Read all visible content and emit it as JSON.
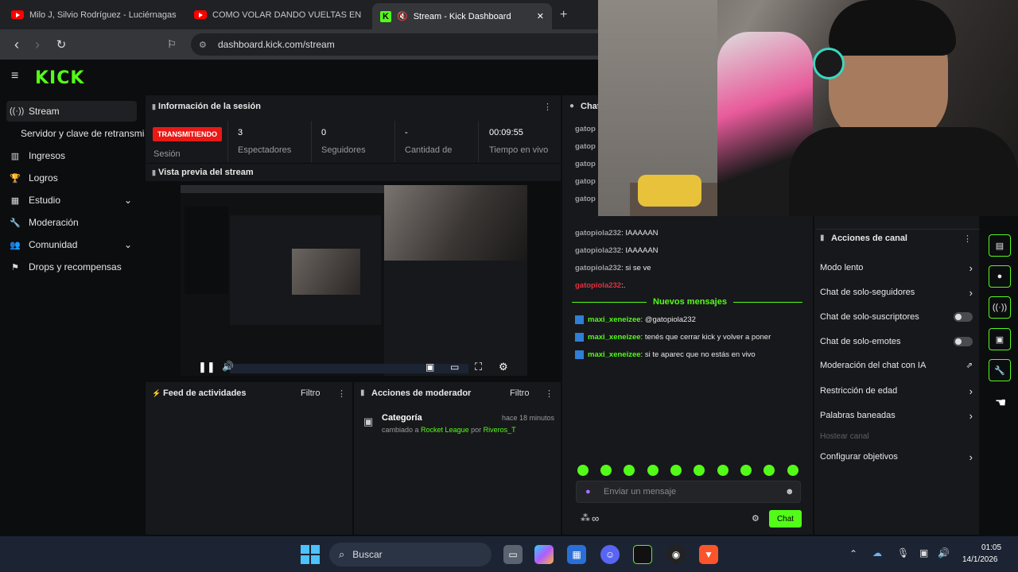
{
  "browser": {
    "tabs": [
      {
        "title": "Milo J, Silvio Rodríguez - Luciérnagas",
        "favicon": "youtube-icon"
      },
      {
        "title": "COMO VOLAR DANDO VUELTAS EN P",
        "favicon": "youtube-icon"
      },
      {
        "title": "Stream - Kick Dashboard",
        "favicon": "kick-icon"
      }
    ],
    "new_tab": "+",
    "close": "✕",
    "url": "dashboard.kick.com/stream"
  },
  "brand": {
    "logo": "KICK",
    "accent": "#53fc18"
  },
  "sidebar": {
    "items": [
      {
        "label": "Stream",
        "icon": "broadcast-icon"
      },
      {
        "label": "Servidor y clave de retransmisión",
        "icon": ""
      },
      {
        "label": "Ingresos",
        "icon": "chart-icon"
      },
      {
        "label": "Logros",
        "icon": "trophy-icon"
      },
      {
        "label": "Estudio",
        "icon": "layout-icon"
      },
      {
        "label": "Moderación",
        "icon": "wrench-icon"
      },
      {
        "label": "Comunidad",
        "icon": "people-icon"
      },
      {
        "label": "Drops y recompensas",
        "icon": "gift-icon"
      }
    ]
  },
  "session": {
    "title": "Información de la sesión",
    "status_badge": "TRANSMITIENDO",
    "status_label": "Sesión",
    "stats": [
      {
        "value": "3",
        "label": "Espectadores"
      },
      {
        "value": "0",
        "label": "Seguidores"
      },
      {
        "value": "-",
        "label": "Cantidad de"
      },
      {
        "value": "00:09:55",
        "label": "Tiempo en vivo"
      }
    ]
  },
  "preview": {
    "title": "Vista previa del stream"
  },
  "activity": {
    "title": "Feed de actividades",
    "filter": "Filtro"
  },
  "modactions": {
    "title": "Acciones de moderador",
    "filter": "Filtro",
    "item_title": "Categoría",
    "item_time": "hace 18 minutos",
    "item_prefix": "cambiado a",
    "item_value": "Rocket League",
    "item_by": "por",
    "item_user": "Riveros_T"
  },
  "chat": {
    "title": "Chat",
    "early_users": [
      "gatop",
      "gatop",
      "gatop",
      "gatop",
      "gatop"
    ],
    "messages": [
      {
        "user": "gatopiola232",
        "text": ": IAAAAAN"
      },
      {
        "user": "gatopiola232",
        "text": ": IAAAAAN"
      },
      {
        "user": "gatopiola232",
        "text": ": si se ve"
      },
      {
        "user": "gatopiola232",
        "text": ":."
      }
    ],
    "new_messages": "Nuevos mensajes",
    "new": [
      {
        "user": "maxi_xeneizee",
        "text": ": @gatopiola232"
      },
      {
        "user": "maxi_xeneizee",
        "text": ": tenés que cerrar kick y volver a poner"
      },
      {
        "user": "maxi_xeneizee",
        "text": ": si te aparec que no estás en vivo"
      }
    ],
    "input_placeholder": "Enviar un mensaje",
    "send": "Chat",
    "points": "∞"
  },
  "channel_actions": {
    "title": "Acciones de canal",
    "rows": [
      {
        "label": "Modo lento",
        "control": "chevron"
      },
      {
        "label": "Chat de solo-seguidores",
        "control": "chevron"
      },
      {
        "label": "Chat de solo-suscriptores",
        "control": "toggle"
      },
      {
        "label": "Chat de solo-emotes",
        "control": "toggle"
      },
      {
        "label": "Moderación del chat con IA",
        "control": "external"
      },
      {
        "label": "Restricción de edad",
        "control": "chevron"
      },
      {
        "label": "Palabras baneadas",
        "control": "chevron"
      },
      {
        "label": "Hostear canal",
        "control": "none"
      },
      {
        "label": "Configurar objetivos",
        "control": "chevron"
      }
    ]
  },
  "taskbar": {
    "search": "Buscar",
    "time": "01:05",
    "date": "14/1/2026"
  }
}
